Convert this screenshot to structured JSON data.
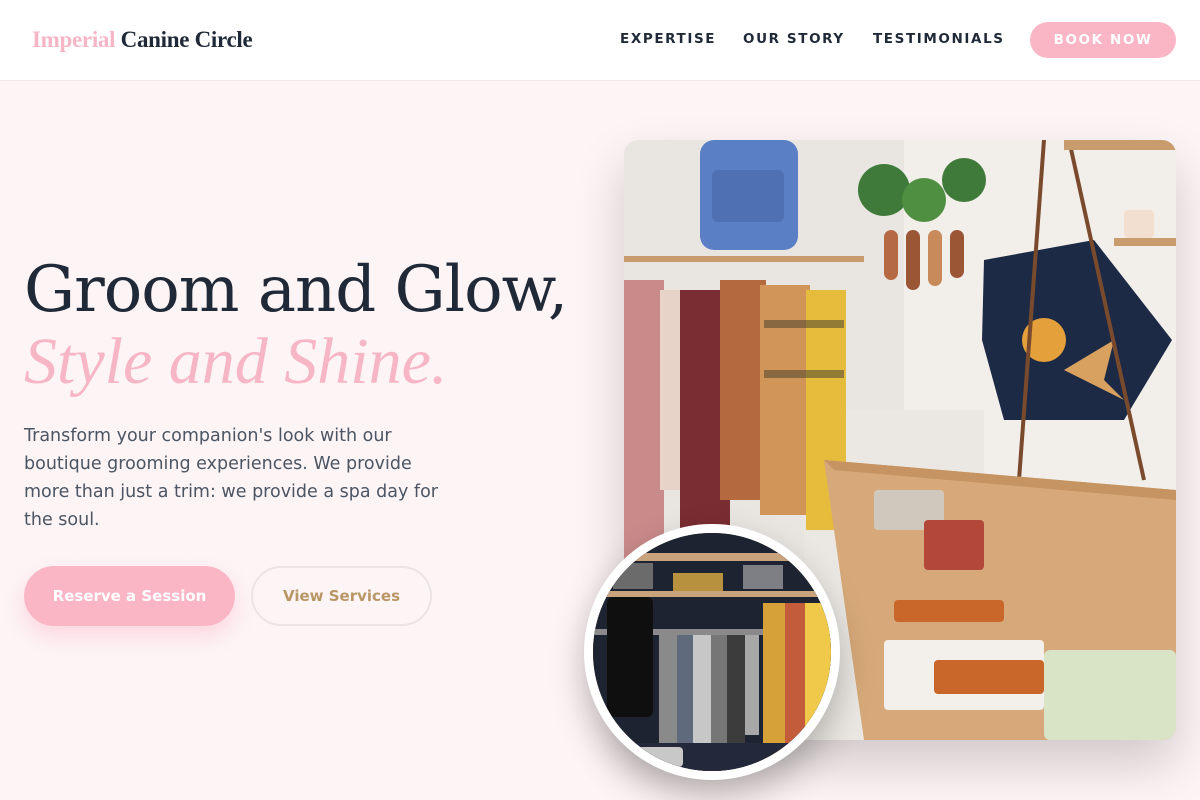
{
  "header": {
    "brand_part1": "Imperial",
    "brand_part2": "Canine Circle",
    "nav": [
      {
        "label": "EXPERTISE"
      },
      {
        "label": "OUR STORY"
      },
      {
        "label": "TESTIMONIALS"
      }
    ],
    "book_label": "BOOK NOW"
  },
  "hero": {
    "headline": "Groom and Glow,",
    "headline_accent": "Style and Shine.",
    "description": "Transform your companion's look with our boutique grooming experiences. We provide more than just a trim: we provide a spa day for the soul.",
    "primary_cta": "Reserve a Session",
    "secondary_cta": "View Services"
  },
  "colors": {
    "accent_pink": "#fbb6c6",
    "headline_dark": "#1f2937",
    "gold": "#b99666",
    "page_background": "#fdf4f5"
  },
  "images": {
    "main": "boutique-shop-photo",
    "inset": "clothing-rack-photo"
  }
}
